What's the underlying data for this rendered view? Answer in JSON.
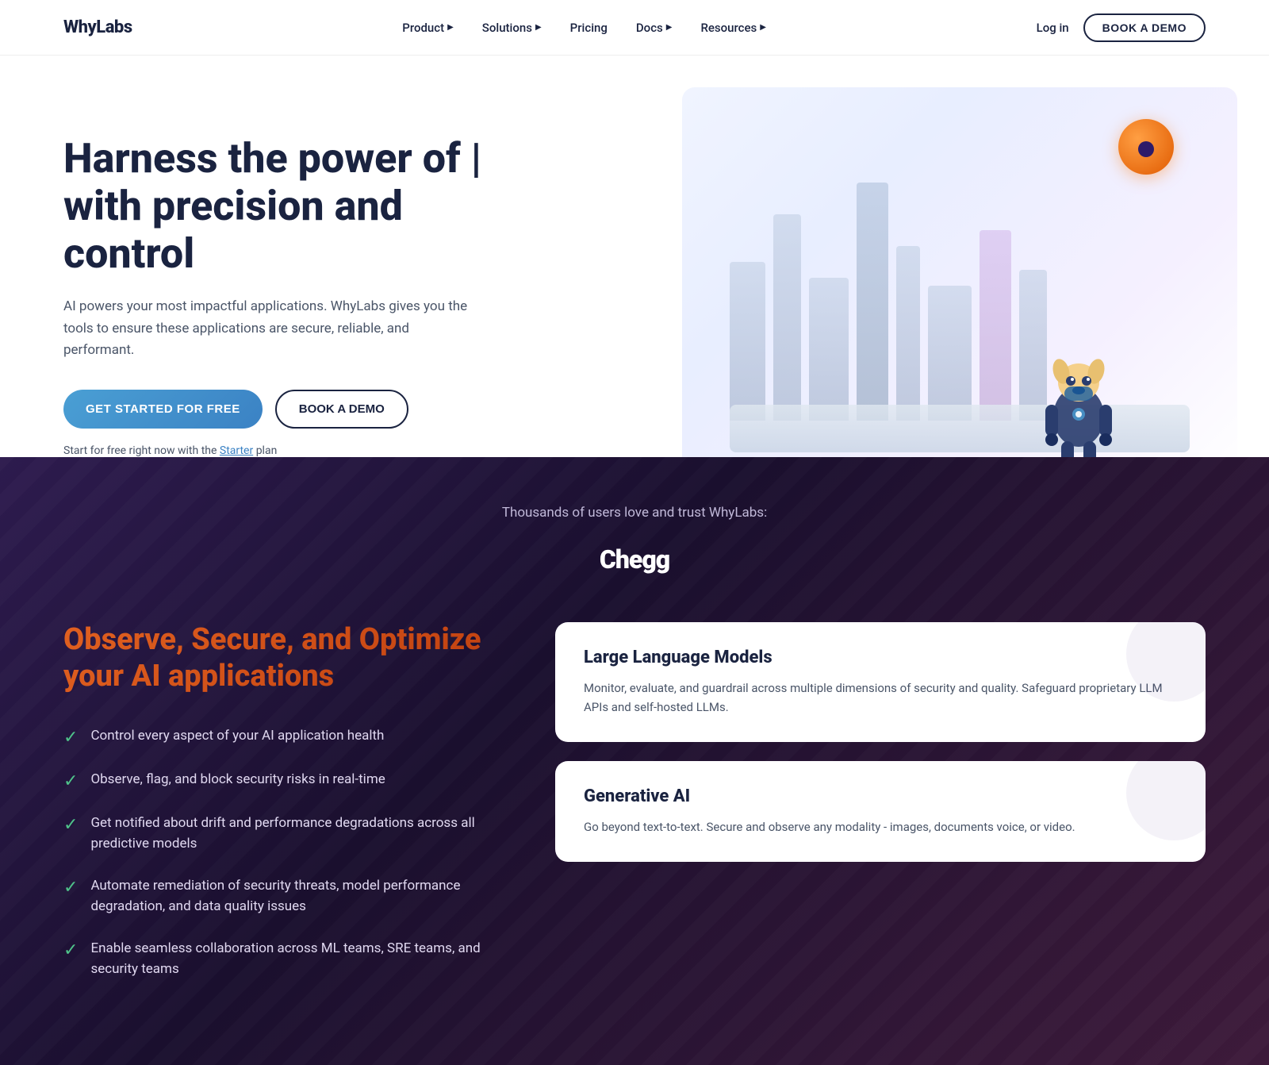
{
  "nav": {
    "logo": "WhyLabs",
    "links": [
      {
        "label": "Product",
        "has_dropdown": true
      },
      {
        "label": "Solutions",
        "has_dropdown": true
      },
      {
        "label": "Pricing",
        "has_dropdown": false
      },
      {
        "label": "Docs",
        "has_dropdown": true
      },
      {
        "label": "Resources",
        "has_dropdown": true
      }
    ],
    "login_label": "Log in",
    "book_demo_label": "BOOK A DEMO"
  },
  "hero": {
    "title_line1": "Harness the power of |",
    "title_line2": "with precision and control",
    "description": "AI powers your most impactful applications. WhyLabs gives you the tools to ensure these applications are secure, reliable, and performant.",
    "cta_primary": "GET STARTED FOR FREE",
    "cta_secondary": "BOOK A DEMO",
    "starter_prefix": "Start for free right now with the ",
    "starter_link": "Starter",
    "starter_suffix": " plan"
  },
  "trust": {
    "text": "Thousands of users love and trust WhyLabs:",
    "logos": [
      "Chegg"
    ]
  },
  "features": {
    "title_line1": "Observe, Secure, and Optimize",
    "title_line2": "your AI applications",
    "items": [
      "Control every aspect of your AI application health",
      "Observe, flag, and block security risks in real-time",
      "Get notified about drift and performance degradations across all predictive models",
      "Automate remediation of security threats, model performance degradation, and data quality issues",
      "Enable seamless collaboration across ML teams, SRE teams, and security teams"
    ],
    "cards": [
      {
        "title": "Large Language Models",
        "description": "Monitor, evaluate, and guardrail across multiple dimensions of security and quality. Safeguard proprietary LLM APIs and self-hosted LLMs."
      },
      {
        "title": "Generative AI",
        "description": "Go beyond text-to-text. Secure and observe any modality - images, documents voice, or video."
      }
    ]
  }
}
